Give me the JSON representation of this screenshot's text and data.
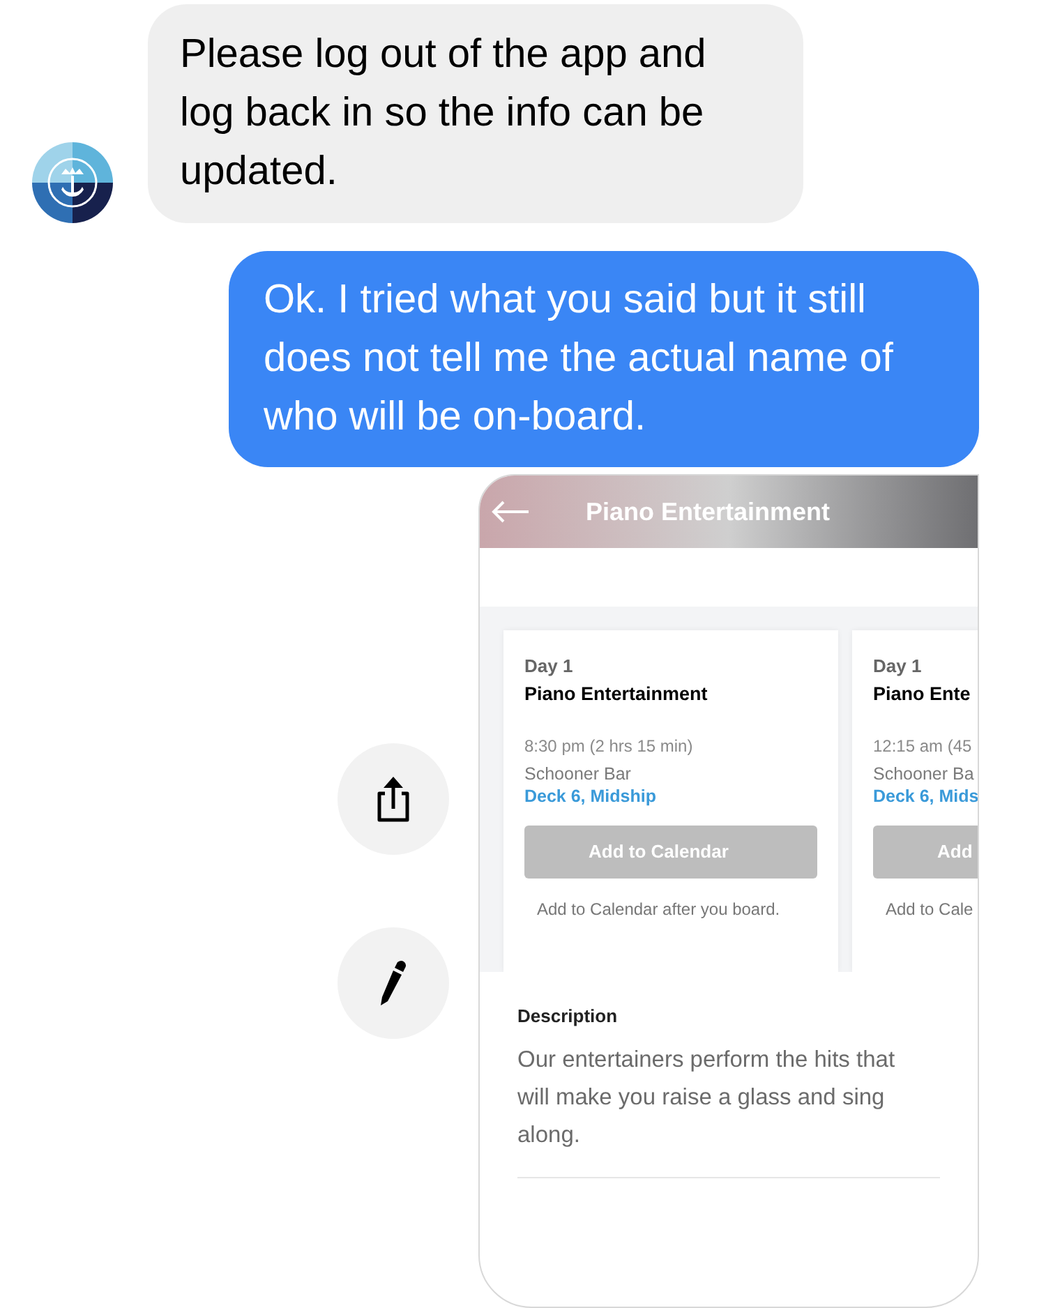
{
  "messages": [
    {
      "kind": "incoming",
      "text": "Please log out of the app and log back in so the info can be updated."
    },
    {
      "kind": "outgoing",
      "text": "Ok. I tried what you said but it still does not tell me the actual name of who will be on-board."
    }
  ],
  "actions": [
    {
      "kind": "share"
    },
    {
      "kind": "edit"
    }
  ],
  "screenshot": {
    "header_title": "Piano Entertainment",
    "cards": [
      {
        "day": "Day 1",
        "title": "Piano Entertainment",
        "time": "8:30 pm (2 hrs 15 min)",
        "venue": "Schooner Bar",
        "location": "Deck 6, Midship",
        "button": "Add to Calendar",
        "disabled": true,
        "note": "Add to Calendar after you board."
      },
      {
        "day": "Day 1",
        "title": "Piano Ente",
        "time": "12:15 am (45",
        "venue": "Schooner Ba",
        "location": "Deck 6, Mids",
        "button": "Add",
        "disabled": true,
        "note": "Add to Cale"
      }
    ],
    "description": {
      "label": "Description",
      "text": "Our entertainers perform the hits that will make you raise a glass and sing along."
    }
  }
}
